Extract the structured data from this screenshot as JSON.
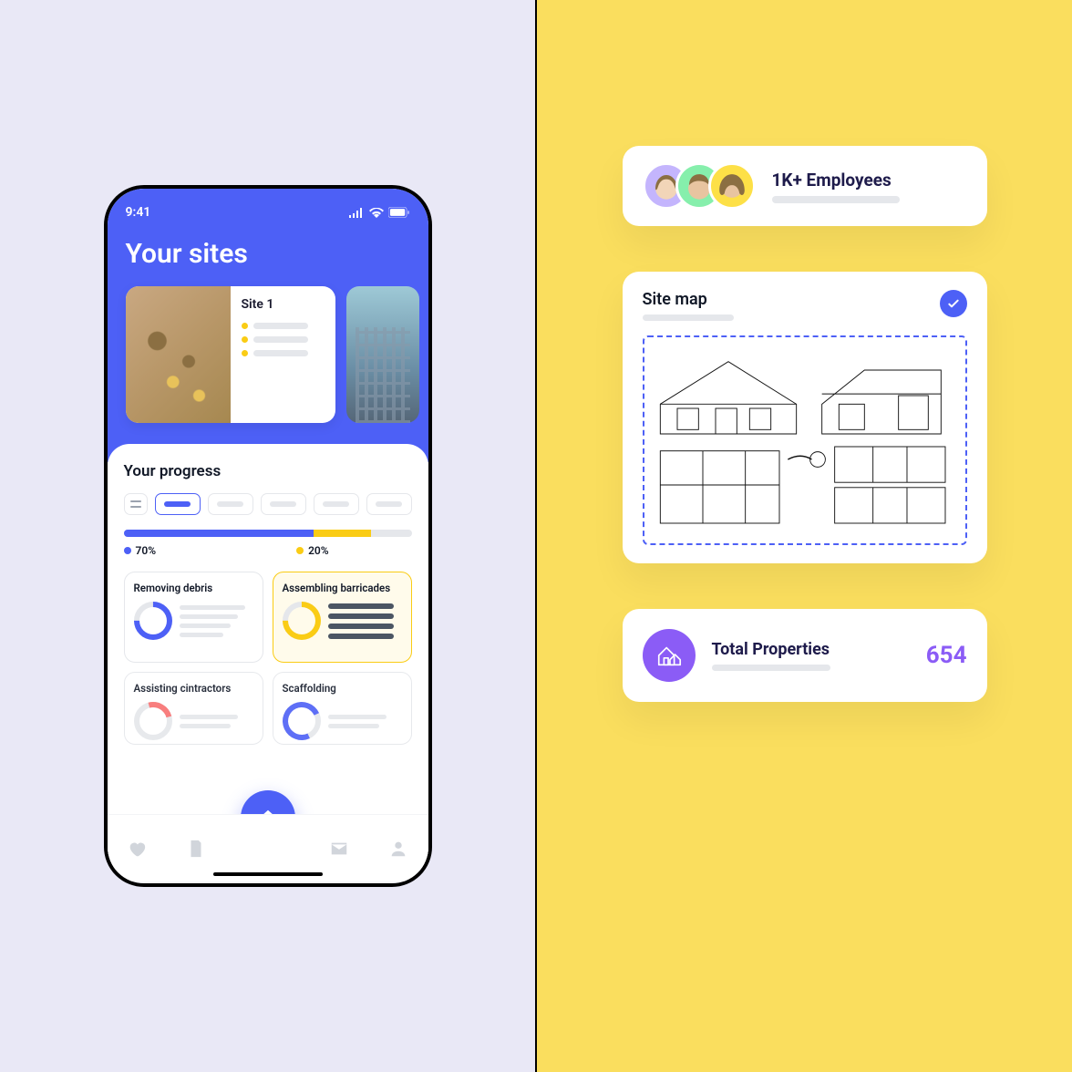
{
  "status_bar": {
    "time": "9:41"
  },
  "header": {
    "title": "Your sites"
  },
  "sites": [
    {
      "name": "Site 1"
    }
  ],
  "progress": {
    "title": "Your progress",
    "segments": [
      {
        "label": "70%",
        "color": "#4D60F6"
      },
      {
        "label": "20%",
        "color": "#FACC15"
      }
    ]
  },
  "tasks": [
    {
      "title": "Removing debris"
    },
    {
      "title": "Assembling barricades"
    },
    {
      "title": "Assisting cintractors"
    },
    {
      "title": "Scaffolding"
    }
  ],
  "employees_card": {
    "title": "1K+ Employees"
  },
  "sitemap_card": {
    "title": "Site map"
  },
  "properties_card": {
    "title": "Total Properties",
    "value": "654"
  },
  "colors": {
    "primary": "#4D60F6",
    "accent_yellow": "#FACC15",
    "accent_purple": "#8B5CF6"
  }
}
